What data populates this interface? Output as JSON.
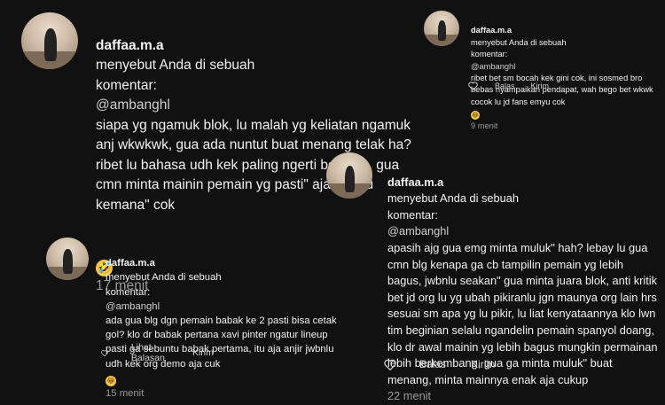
{
  "comments": [
    {
      "username": "daffaa.m.a",
      "line1": "menyebut Anda di sebuah",
      "prefix": "komentar:",
      "mention": "@ambanghl",
      "body": "siapa yg ngamuk blok, lu malah yg keliatan ngamuk anj wkwkwk, gua ada nuntut buat menang telak ha? ribet lu bahasa udh kek paling ngerti bola lah, gua cmn minta mainin pemain yg pasti\" aja jwbnlu kemana\" cok",
      "emoji": "🤣",
      "time": "17 menit"
    },
    {
      "username": "daffaa.m.a",
      "line1": "menyebut Anda di sebuah",
      "prefix": "komentar:",
      "mention": "@ambanghl",
      "body": "ribet bet sm bocah kek gini cok, ini sosmed bro bebas nyampaikan pendapat, wah bego bet wkwk cocok lu jd fans emyu cok",
      "emoji": "😂",
      "time": "9 menit",
      "reply_label": "Balas",
      "send_label": "Kirim"
    },
    {
      "username": "daffaa.m.a",
      "line1": "menyebut Anda di sebuah",
      "prefix": "komentar:",
      "mention": "@ambanghl",
      "body": "apasih ajg gua emg minta muluk\" hah? lebay lu gua cmn blg kenapa ga cb tampilin pemain yg lebih bagus, jwbnlu seakan\" gua minta juara blok, anti kritik bet jd org lu yg ubah pikiranlu jgn maunya org lain hrs sesuai sm apa yg lu pikir, lu liat kenyataannya klo lwn tim beginian selalu ngandelin pemain spanyol doang, klo dr awal mainin yg lebih bagus mungkin permainan lebih berkembang, gua ga minta muluk\" buat menang, minta mainnya enak aja cukup",
      "time": "22 menit",
      "reply_label": "Balas",
      "send_label": "Kirim"
    },
    {
      "username": "daffaa.m.a",
      "line1": "menyebut Anda di sebuah",
      "prefix": "komentar:",
      "mention": "@ambanghl",
      "body": "ada gua blg dgn pemain babak ke 2 pasti bisa cetak gol? klo dr babak pertana xavi pinter ngatur lineup pasti ga sebuntu babak pertama, itu aja anjir jwbnlu udh kek org demo aja cuk",
      "emoji": "😂",
      "time": "15 menit",
      "reply_label": "Lihat Balasan",
      "send_label": "Kirim"
    }
  ],
  "icons": {
    "like": "heart-icon",
    "avatar": "profile-avatar"
  },
  "colors": {
    "background": "#111111",
    "text": "#f2f2f2",
    "muted": "#9a9a9a"
  }
}
